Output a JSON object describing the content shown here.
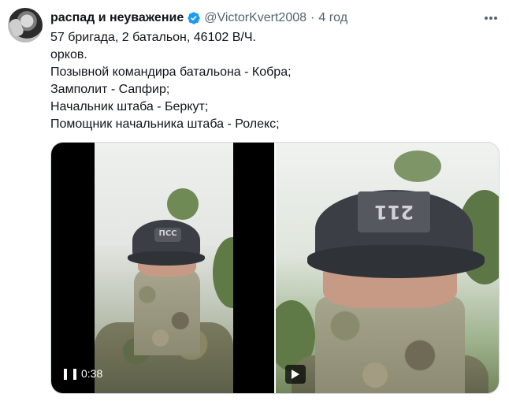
{
  "tweet": {
    "name": "распад и неуважение",
    "handle": "@VictorKvert2008",
    "separator": "·",
    "time": "4 год",
    "lines": [
      "57 бригада, 2 батальон, 46102 В/Ч.",
      "орков.",
      "Позывной командира батальона - Кобра;",
      "Замполит - Сапфир;",
      "Начальник штаба - Беркут;",
      "Помощник начальника штаба - Ролекс;"
    ]
  },
  "media": {
    "video_left": {
      "time": "0:38",
      "cap_label": "ПСС"
    },
    "video_right": {
      "cap_label": "211"
    }
  },
  "colors": {
    "verified": "#1d9bf0",
    "secondary": "#536471"
  },
  "icons": [
    "verified-badge-icon",
    "more-icon",
    "pause-icon",
    "play-icon"
  ]
}
